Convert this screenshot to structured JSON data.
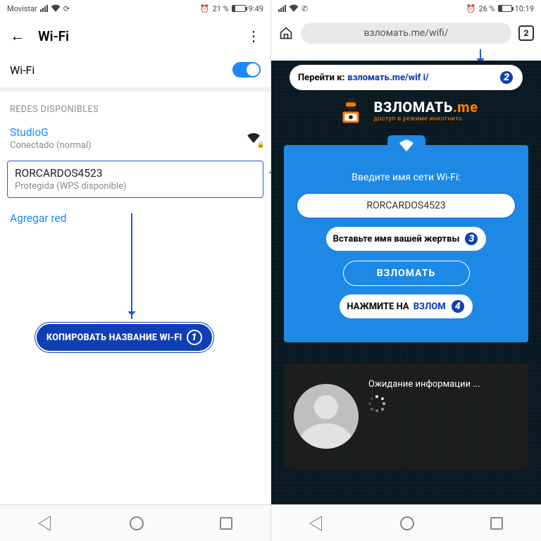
{
  "left": {
    "status": {
      "carrier": "Movistar",
      "battery": "21 %",
      "time": "9:49"
    },
    "header_title": "Wi-Fi",
    "wifi_label": "Wi-Fi",
    "section_label": "REDES DISPONIBLES",
    "net1": {
      "name": "StudioG",
      "sub": "Conectado  (normal)"
    },
    "net2": {
      "name": "RORCARDOS4523",
      "sub": "Protegida (WPS disponible)"
    },
    "add_net": "Agregar red",
    "step1_label": "КОПИРОВАТЬ НАЗВАНИЕ WI-FI",
    "step1_num": "1"
  },
  "right": {
    "status": {
      "battery": "26 %",
      "time": "10:19"
    },
    "url": "взломать.me/wifi/",
    "tab_count": "2",
    "step2_prefix": "Перейти к: ",
    "step2_link": "взломать.me/wif i/",
    "step2_num": "2",
    "brand_name1": "ВЗЛОМАТЬ",
    "brand_name2": ".me",
    "brand_tag": "доступ в режиме инкогнито",
    "card_prompt": "Введите имя сети Wi-Fi:",
    "card_field": "RORCARDOS4523",
    "step3_label": "Вставьте имя вашей жертвы",
    "step3_num": "3",
    "hack_btn": "ВЗЛОМАТЬ",
    "step4_prefix": "НАЖМИТЕ НА ",
    "step4_hl": "ВЗЛОМ",
    "step4_num": "4",
    "waiting": "Ожидание информации ..."
  }
}
